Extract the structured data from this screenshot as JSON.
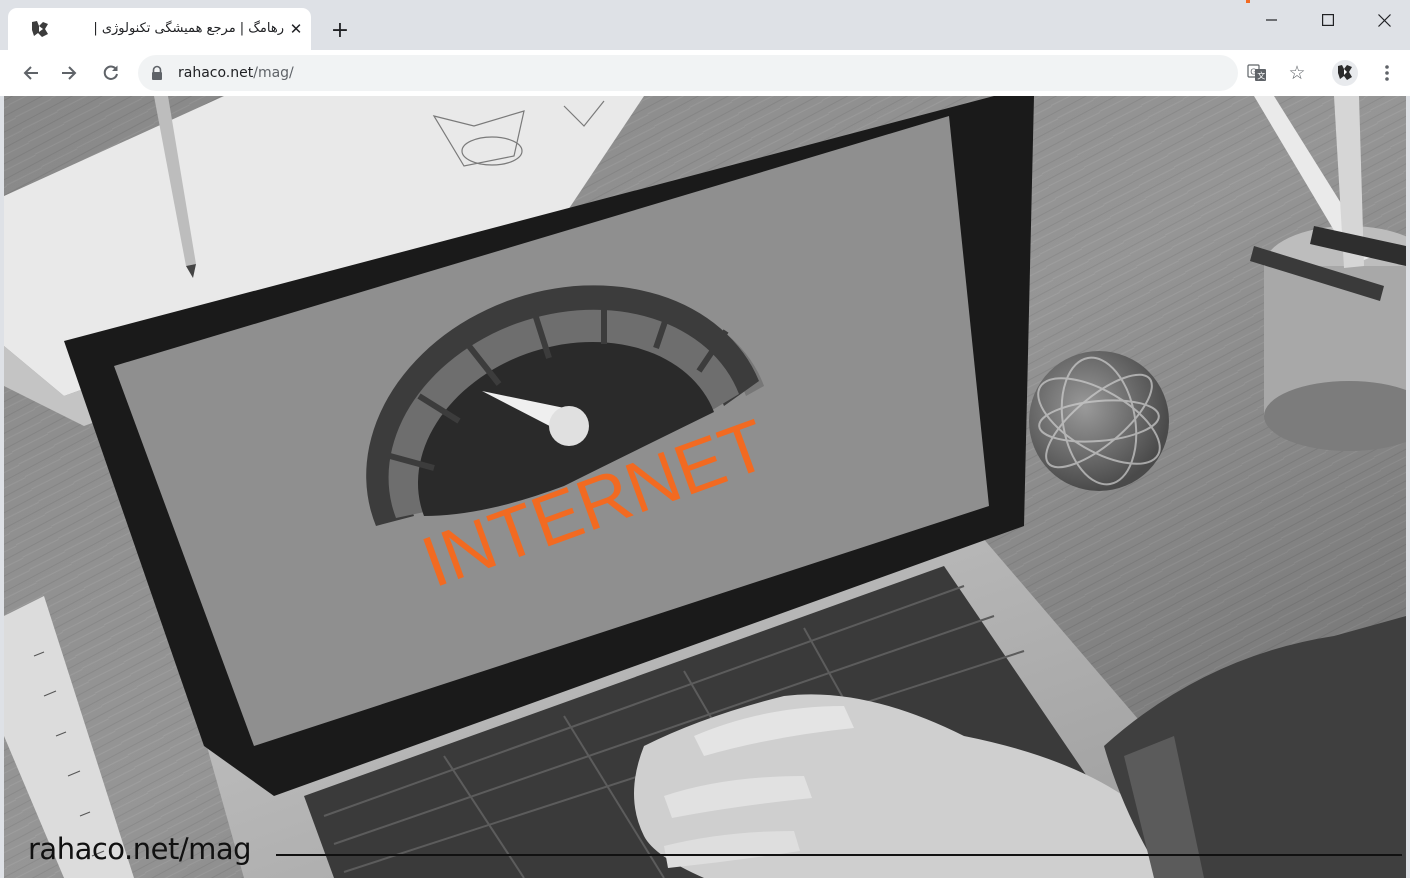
{
  "window": {
    "controls": {
      "minimize": "–",
      "maximize": "☐",
      "close": "✕"
    }
  },
  "tab": {
    "title": "رهامگ | مرجع همیشگی تکنولوژی |",
    "close_glyph": "✕",
    "favicon_icon": "rahaco-logo-icon"
  },
  "new_tab_glyph": "+",
  "toolbar": {
    "back_icon": "arrow-left-icon",
    "forward_icon": "arrow-right-icon",
    "reload_icon": "reload-icon",
    "url_host": "rahaco.net",
    "url_path": "/mag/",
    "lock_icon": "lock-icon",
    "translate_icon": "translate-icon",
    "star_glyph": "☆",
    "extension_icon": "rahaco-extension-icon",
    "menu_icon": "kebab-menu-icon"
  },
  "page": {
    "screen_text": "INTERNET",
    "watermark": "rahaco.net/mag"
  },
  "colors": {
    "accent": "#f26a21",
    "tabstrip": "#dee1e6",
    "toolbar": "#ffffff",
    "omnibox": "#f1f3f4"
  }
}
